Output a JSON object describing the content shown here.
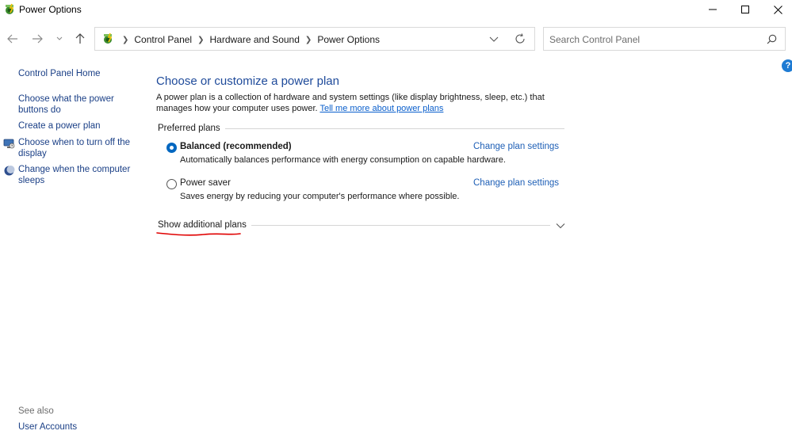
{
  "window": {
    "title": "Power Options"
  },
  "navigation": {
    "breadcrumbs": [
      "Control Panel",
      "Hardware and Sound",
      "Power Options"
    ],
    "search_placeholder": "Search Control Panel"
  },
  "sidebar": {
    "home_label": "Control Panel Home",
    "links": [
      {
        "label": "Choose what the power buttons do",
        "icon": null
      },
      {
        "label": "Create a power plan",
        "icon": null
      },
      {
        "label": "Choose when to turn off the display",
        "icon": "monitor-icon"
      },
      {
        "label": "Change when the computer sleeps",
        "icon": "moon-icon"
      }
    ],
    "see_also_label": "See also",
    "see_also_links": [
      "User Accounts"
    ]
  },
  "main": {
    "heading": "Choose or customize a power plan",
    "description": "A power plan is a collection of hardware and system settings (like display brightness, sleep, etc.) that manages how your computer uses power.",
    "learn_more_link": "Tell me more about power plans",
    "preferred_plans_label": "Preferred plans",
    "plans": [
      {
        "name": "Balanced (recommended)",
        "description": "Automatically balances performance with energy consumption on capable hardware.",
        "selected": true,
        "link": "Change plan settings"
      },
      {
        "name": "Power saver",
        "description": "Saves energy by reducing your computer's performance where possible.",
        "selected": false,
        "link": "Change plan settings"
      }
    ],
    "show_additional_label": "Show additional plans"
  },
  "colors": {
    "link": "#1a3f86",
    "heading": "#1e4a9a",
    "accent": "#0067c0",
    "annotation": "#e00000"
  }
}
